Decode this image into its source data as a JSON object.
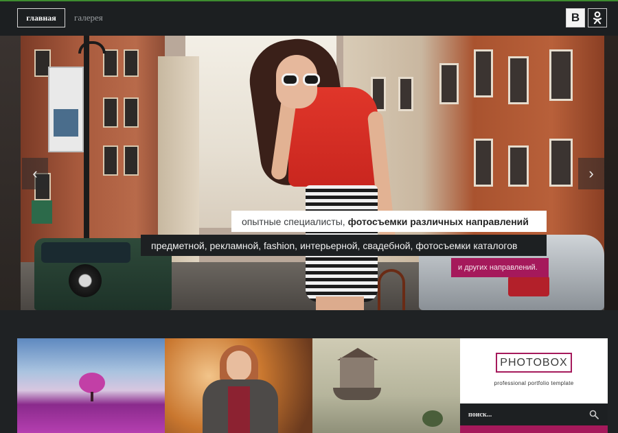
{
  "nav": {
    "items": [
      {
        "label": "главная",
        "active": true
      },
      {
        "label": "галерея",
        "active": false
      }
    ]
  },
  "social": {
    "vk_label": "B",
    "vk_icon": "vk-icon",
    "ok_icon": "odnoklassniki-icon"
  },
  "hero": {
    "caption_line1_regular": "опытные специалисты,",
    "caption_line1_bold": "фотосъемки различных направлений",
    "caption_line2": "предметной, рекламной, fashion, интерьерной, свадебной, фотосъемки каталогов",
    "caption_line3": "и других направлений.",
    "prev_icon": "chevron-left-icon",
    "next_icon": "chevron-right-icon",
    "prev_glyph": "‹",
    "next_glyph": "›"
  },
  "sidebar": {
    "logo_text": "PHOTOBOX",
    "tagline": "professional portfolio template",
    "search_placeholder": "поиск..."
  },
  "colors": {
    "accent": "#a5195b",
    "dark": "#1d2022",
    "topbar": "#1c1f21"
  }
}
